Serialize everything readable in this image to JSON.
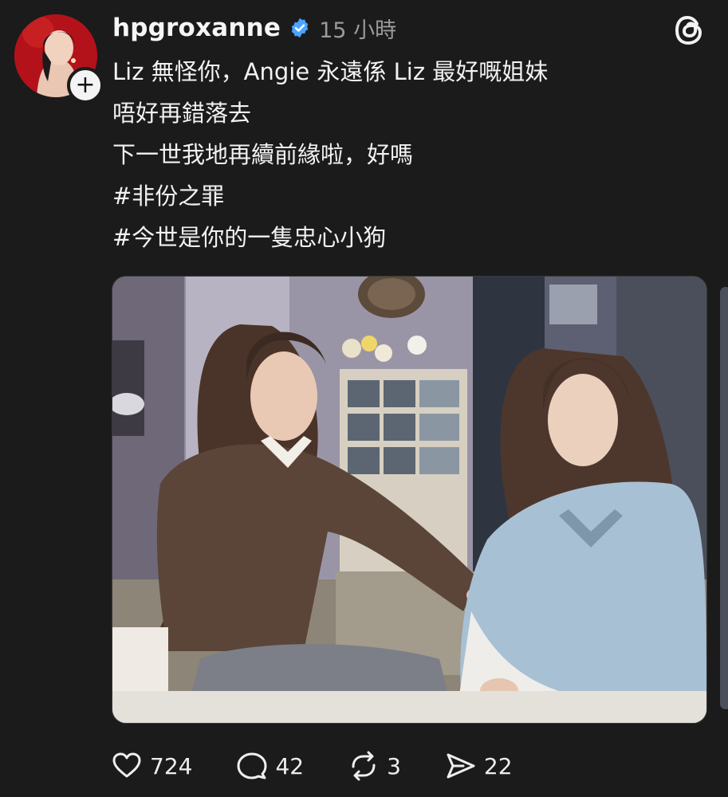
{
  "author": {
    "username": "hpgroxanne",
    "verified": true,
    "timestamp": "15 小時",
    "follow_label": "+"
  },
  "caption": {
    "lines": [
      "Liz 無怪你，Angie 永遠係 Liz 最好嘅姐妹",
      "唔好再錯落去",
      "下一世我地再續前緣啦，好嗎",
      "#非份之罪",
      "#今世是你的一隻忠心小狗"
    ]
  },
  "actions": {
    "likes": "724",
    "comments": "42",
    "reposts": "3",
    "shares": "22"
  },
  "icons": {
    "like": "heart-icon",
    "comment": "comment-bubble-icon",
    "repost": "repost-icon",
    "share": "send-icon",
    "app": "threads-logo-icon",
    "verified": "verified-badge-icon"
  },
  "colors": {
    "background": "#1b1b1b",
    "verified_blue": "#4aa3ff",
    "avatar_red": "#b3121b",
    "muted_text": "#9a9a9a"
  }
}
